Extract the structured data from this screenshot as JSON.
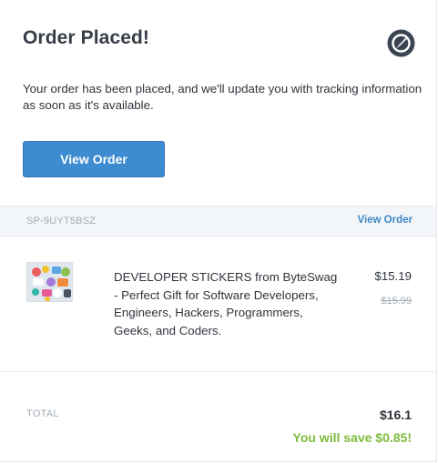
{
  "header": {
    "title": "Order Placed!",
    "logo_icon": "compass-logo-icon"
  },
  "message": "Your order has been placed, and we'll update you with tracking information as soon as it's available.",
  "primary_button": {
    "label": "View Order"
  },
  "order_bar": {
    "order_number": "SP-9UYT5BSZ",
    "link_label": "View Order"
  },
  "items": [
    {
      "name": "DEVELOPER STICKERS from ByteSwag - Perfect Gift for Software Developers, Engineers, Hackers, Programmers, Geeks, and Coders.",
      "price": "$15.19",
      "original_price": "$15.99",
      "thumbnail_icon": "sticker-pack-thumbnail"
    }
  ],
  "summary": {
    "total_label": "TOTAL",
    "total_value": "$16.1",
    "savings_text": "You will save $0.85!"
  },
  "colors": {
    "accent": "#3d8bd0",
    "link": "#3d86c6",
    "savings": "#7dbb3c",
    "bar_bg": "#f3f6f9"
  }
}
